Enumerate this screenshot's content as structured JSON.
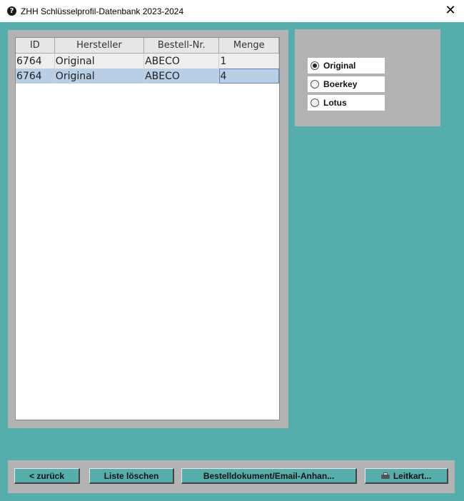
{
  "window": {
    "title": "ZHH Schlüsselprofil-Datenbank 2023-2024",
    "app_icon": "app-logo-icon",
    "close_symbol": "✕"
  },
  "table": {
    "columns": [
      "ID",
      "Hersteller",
      "Bestell-Nr.",
      "Menge"
    ],
    "rows": [
      {
        "id": "6764",
        "hersteller": "Original",
        "bestell_nr": "ABECO",
        "menge": "1"
      },
      {
        "id": "6764",
        "hersteller": "Original",
        "bestell_nr": "ABECO",
        "menge": "4"
      }
    ],
    "selected_row": 1
  },
  "manufacturer_options": [
    {
      "label": "Original",
      "selected": true
    },
    {
      "label": "Boerkey",
      "selected": false
    },
    {
      "label": "Lotus",
      "selected": false
    }
  ],
  "buttons": {
    "back": "< zurück",
    "clear_list": "Liste löschen",
    "order_doc": "Bestelldokument/Email-Anhan...",
    "leitkart": "Leitkart...",
    "leitkart_icon": "printer-icon"
  },
  "colors": {
    "background": "#55aeac",
    "panel": "#b3b3b3",
    "selection": "#b8cfe5"
  }
}
